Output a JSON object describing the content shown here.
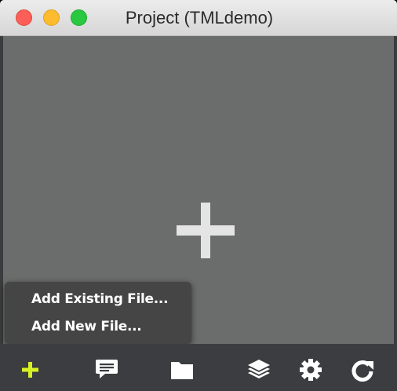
{
  "window": {
    "title": "Project (TMLdemo)"
  },
  "main": {
    "add_icon": "plus-icon"
  },
  "add_menu": {
    "items": [
      {
        "label": "Add Existing File..."
      },
      {
        "label": "Add New File..."
      }
    ]
  },
  "toolbar": {
    "items": [
      {
        "icon": "plus-icon",
        "color": "#d7f224"
      },
      {
        "icon": "comment-icon",
        "color": "#ffffff"
      },
      {
        "icon": "folder-icon",
        "color": "#ffffff"
      },
      {
        "icon": "layers-icon",
        "color": "#ffffff"
      },
      {
        "icon": "gear-icon",
        "color": "#ffffff"
      },
      {
        "icon": "refresh-icon",
        "color": "#ffffff"
      }
    ]
  },
  "colors": {
    "content_bg": "#6b6d6c",
    "toolbar_bg": "#3b3d40",
    "menu_bg": "#454545",
    "accent": "#d7f224"
  }
}
